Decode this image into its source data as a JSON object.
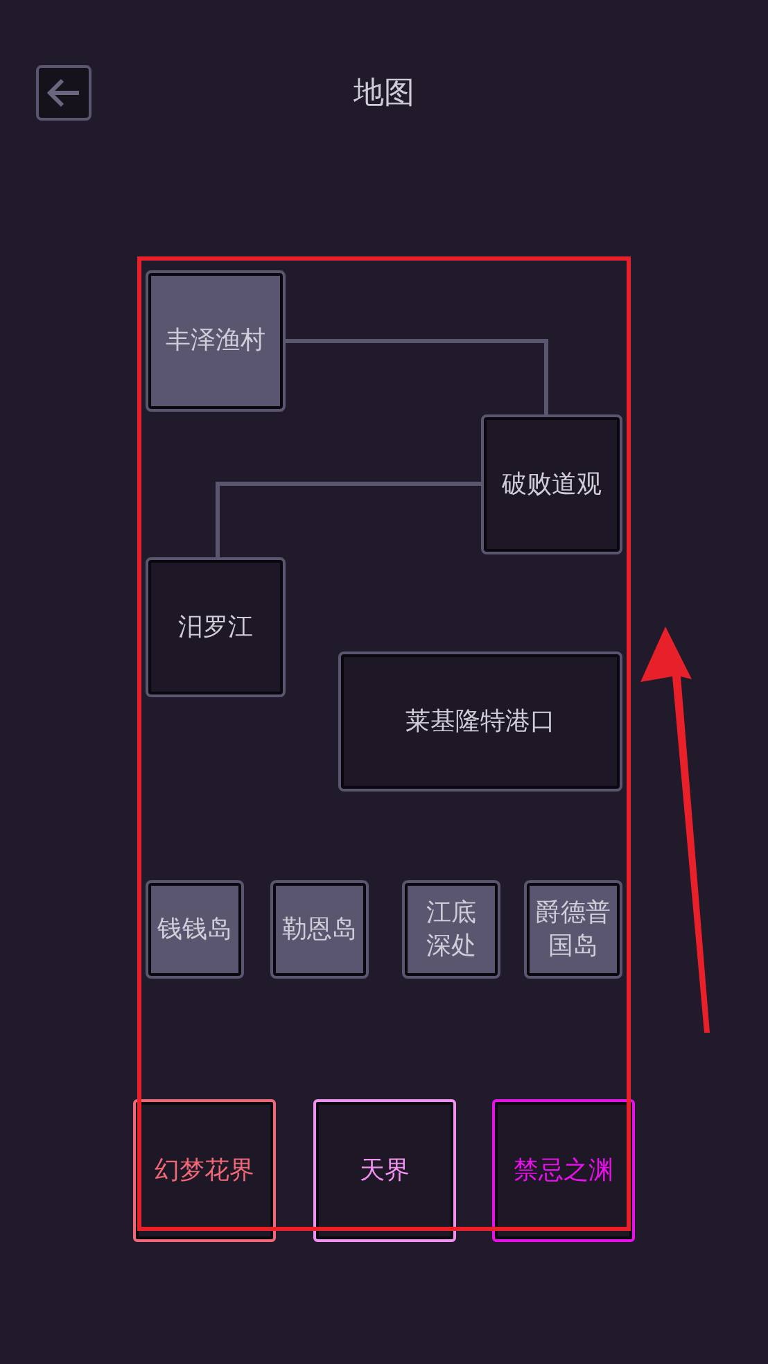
{
  "header": {
    "title": "地图"
  },
  "map": {
    "nodes": [
      {
        "name": "丰泽渔村",
        "highlighted": true
      },
      {
        "name": "破败道观",
        "highlighted": false
      },
      {
        "name": "汨罗江",
        "highlighted": false
      },
      {
        "name": "莱基隆特港口",
        "highlighted": false
      },
      {
        "name": "钱钱岛",
        "highlighted": true
      },
      {
        "name": "勒恩岛",
        "highlighted": true
      },
      {
        "name": "江底深处",
        "highlighted": true
      },
      {
        "name": "爵德普国岛",
        "highlighted": true
      }
    ],
    "portals": [
      {
        "name": "幻梦花界",
        "color": "#f06878"
      },
      {
        "name": "天界",
        "color": "#f090f0"
      },
      {
        "name": "禁忌之渊",
        "color": "#e810e8"
      }
    ]
  }
}
